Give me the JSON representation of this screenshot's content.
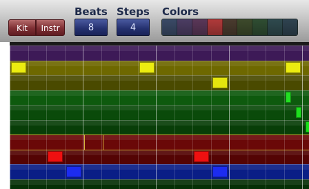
{
  "toolbar": {
    "kit_label": "Kit",
    "instr_label": "Instr",
    "beats_label": "Beats",
    "beats_value": "8",
    "steps_label": "Steps",
    "steps_value": "4",
    "colors_label": "Colors"
  },
  "palette": [
    "#3a4a66",
    "#4c3d63",
    "#5a3758",
    "#b03a3a",
    "#4a3b2e",
    "#3d4a2b",
    "#2f4d32",
    "#2f4a4e",
    "#2f4350"
  ],
  "grid": {
    "columns": 17,
    "beat_every": 4,
    "rows": [
      {
        "color": "#3d1a57"
      },
      {
        "color": "#6e6800"
      },
      {
        "color": "#4a4a00"
      },
      {
        "color": "#0e5a0e"
      },
      {
        "color": "#0a4a0a"
      },
      {
        "color": "#083e08"
      },
      {
        "color": "#6a0808"
      },
      {
        "color": "#540404"
      },
      {
        "color": "#0a1e86"
      },
      {
        "color": "#063006"
      }
    ],
    "notes": [
      {
        "row": 1,
        "step": 0,
        "color": "#ecec10"
      },
      {
        "row": 1,
        "step": 7,
        "color": "#ecec10"
      },
      {
        "row": 1,
        "step": 15,
        "color": "#ecec10"
      },
      {
        "row": 2,
        "step": 11,
        "color": "#e4e40e"
      },
      {
        "row": 3,
        "step": 15,
        "color": "#22e022"
      },
      {
        "row": 4,
        "step": 15.6,
        "color": "#1ee01e"
      },
      {
        "row": 5,
        "step": 16.1,
        "color": "#18e018"
      },
      {
        "row": 7,
        "step": 2,
        "color": "#ee1010"
      },
      {
        "row": 7,
        "step": 10,
        "color": "#ee1010"
      },
      {
        "row": 8,
        "step": 3,
        "color": "#1c2cf0"
      },
      {
        "row": 8,
        "step": 11,
        "color": "#1c2cf0"
      }
    ]
  }
}
